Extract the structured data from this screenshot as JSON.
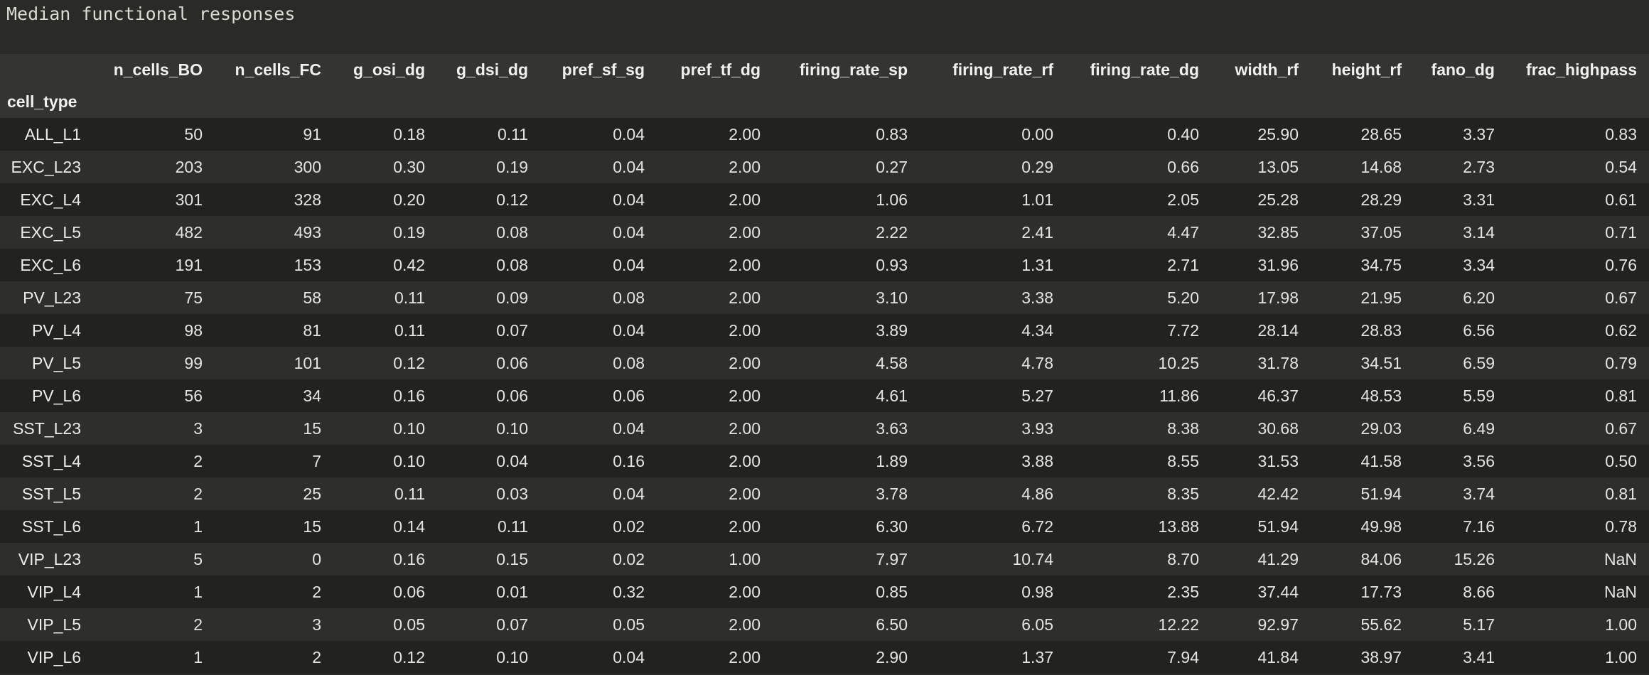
{
  "output": {
    "label": "Median functional responses"
  },
  "table": {
    "index_name": "cell_type",
    "columns": [
      "n_cells_BO",
      "n_cells_FC",
      "g_osi_dg",
      "g_dsi_dg",
      "pref_sf_sg",
      "pref_tf_dg",
      "firing_rate_sp",
      "firing_rate_rf",
      "firing_rate_dg",
      "width_rf",
      "height_rf",
      "fano_dg",
      "frac_highpass"
    ],
    "rows": [
      {
        "index": "ALL_L1",
        "cells": [
          "50",
          "91",
          "0.18",
          "0.11",
          "0.04",
          "2.00",
          "0.83",
          "0.00",
          "0.40",
          "25.90",
          "28.65",
          "3.37",
          "0.83"
        ]
      },
      {
        "index": "EXC_L23",
        "cells": [
          "203",
          "300",
          "0.30",
          "0.19",
          "0.04",
          "2.00",
          "0.27",
          "0.29",
          "0.66",
          "13.05",
          "14.68",
          "2.73",
          "0.54"
        ]
      },
      {
        "index": "EXC_L4",
        "cells": [
          "301",
          "328",
          "0.20",
          "0.12",
          "0.04",
          "2.00",
          "1.06",
          "1.01",
          "2.05",
          "25.28",
          "28.29",
          "3.31",
          "0.61"
        ]
      },
      {
        "index": "EXC_L5",
        "cells": [
          "482",
          "493",
          "0.19",
          "0.08",
          "0.04",
          "2.00",
          "2.22",
          "2.41",
          "4.47",
          "32.85",
          "37.05",
          "3.14",
          "0.71"
        ]
      },
      {
        "index": "EXC_L6",
        "cells": [
          "191",
          "153",
          "0.42",
          "0.08",
          "0.04",
          "2.00",
          "0.93",
          "1.31",
          "2.71",
          "31.96",
          "34.75",
          "3.34",
          "0.76"
        ]
      },
      {
        "index": "PV_L23",
        "cells": [
          "75",
          "58",
          "0.11",
          "0.09",
          "0.08",
          "2.00",
          "3.10",
          "3.38",
          "5.20",
          "17.98",
          "21.95",
          "6.20",
          "0.67"
        ]
      },
      {
        "index": "PV_L4",
        "cells": [
          "98",
          "81",
          "0.11",
          "0.07",
          "0.04",
          "2.00",
          "3.89",
          "4.34",
          "7.72",
          "28.14",
          "28.83",
          "6.56",
          "0.62"
        ]
      },
      {
        "index": "PV_L5",
        "cells": [
          "99",
          "101",
          "0.12",
          "0.06",
          "0.08",
          "2.00",
          "4.58",
          "4.78",
          "10.25",
          "31.78",
          "34.51",
          "6.59",
          "0.79"
        ]
      },
      {
        "index": "PV_L6",
        "cells": [
          "56",
          "34",
          "0.16",
          "0.06",
          "0.06",
          "2.00",
          "4.61",
          "5.27",
          "11.86",
          "46.37",
          "48.53",
          "5.59",
          "0.81"
        ]
      },
      {
        "index": "SST_L23",
        "cells": [
          "3",
          "15",
          "0.10",
          "0.10",
          "0.04",
          "2.00",
          "3.63",
          "3.93",
          "8.38",
          "30.68",
          "29.03",
          "6.49",
          "0.67"
        ]
      },
      {
        "index": "SST_L4",
        "cells": [
          "2",
          "7",
          "0.10",
          "0.04",
          "0.16",
          "2.00",
          "1.89",
          "3.88",
          "8.55",
          "31.53",
          "41.58",
          "3.56",
          "0.50"
        ]
      },
      {
        "index": "SST_L5",
        "cells": [
          "2",
          "25",
          "0.11",
          "0.03",
          "0.04",
          "2.00",
          "3.78",
          "4.86",
          "8.35",
          "42.42",
          "51.94",
          "3.74",
          "0.81"
        ]
      },
      {
        "index": "SST_L6",
        "cells": [
          "1",
          "15",
          "0.14",
          "0.11",
          "0.02",
          "2.00",
          "6.30",
          "6.72",
          "13.88",
          "51.94",
          "49.98",
          "7.16",
          "0.78"
        ]
      },
      {
        "index": "VIP_L23",
        "cells": [
          "5",
          "0",
          "0.16",
          "0.15",
          "0.02",
          "1.00",
          "7.97",
          "10.74",
          "8.70",
          "41.29",
          "84.06",
          "15.26",
          "NaN"
        ]
      },
      {
        "index": "VIP_L4",
        "cells": [
          "1",
          "2",
          "0.06",
          "0.01",
          "0.32",
          "2.00",
          "0.85",
          "0.98",
          "2.35",
          "37.44",
          "17.73",
          "8.66",
          "NaN"
        ]
      },
      {
        "index": "VIP_L5",
        "cells": [
          "2",
          "3",
          "0.05",
          "0.07",
          "0.05",
          "2.00",
          "6.50",
          "6.05",
          "12.22",
          "92.97",
          "55.62",
          "5.17",
          "1.00"
        ]
      },
      {
        "index": "VIP_L6",
        "cells": [
          "1",
          "2",
          "0.12",
          "0.10",
          "0.04",
          "2.00",
          "2.90",
          "1.37",
          "7.94",
          "41.84",
          "38.97",
          "3.41",
          "1.00"
        ]
      }
    ]
  }
}
